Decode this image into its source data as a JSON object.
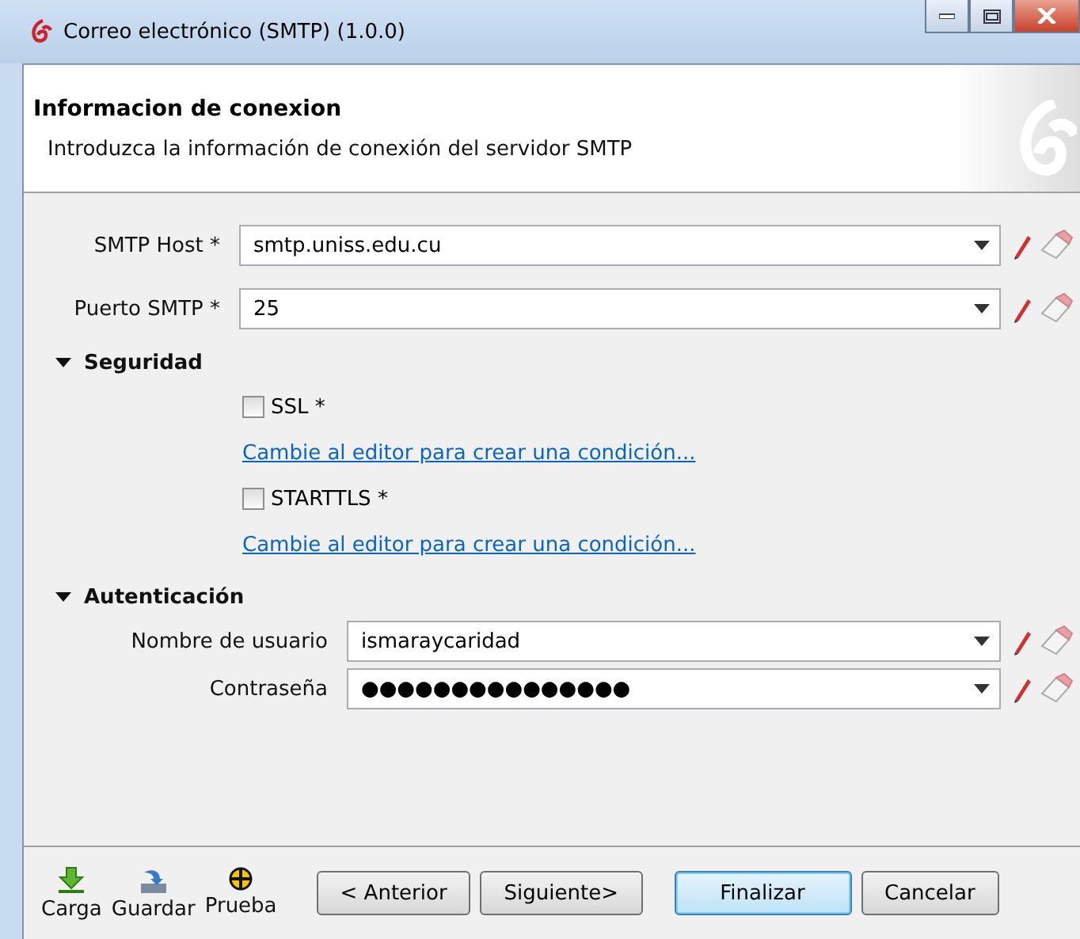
{
  "window": {
    "title": "Correo electrónico (SMTP) (1.0.0)"
  },
  "header": {
    "title": "Informacion de conexion",
    "subtitle": "Introduzca la información de conexión del servidor SMTP"
  },
  "fields": [
    {
      "label": "SMTP Host *",
      "value": "smtp.uniss.edu.cu"
    },
    {
      "label": "Puerto SMTP *",
      "value": "25"
    }
  ],
  "sections": [
    {
      "title": "Seguridad",
      "expanded": true,
      "kind": "options",
      "options": [
        {
          "label": "SSL *",
          "checked": false,
          "link": "Cambie al editor para crear una condición..."
        },
        {
          "label": "STARTTLS *",
          "checked": false,
          "link": "Cambie al editor para crear una condición..."
        }
      ]
    },
    {
      "title": "Autenticación",
      "expanded": true,
      "kind": "fields",
      "fields": [
        {
          "label": "Nombre de usuario",
          "value": "ismaraycaridad"
        },
        {
          "label": "Contraseña",
          "value": "●●●●●●●●●●●●●●●"
        }
      ]
    }
  ],
  "tools": [
    {
      "label": "Carga",
      "kind": "load"
    },
    {
      "label": "Guardar",
      "kind": "save"
    },
    {
      "label": "Prueba",
      "kind": "test"
    }
  ],
  "buttons": [
    {
      "label": "< Anterior",
      "default": false
    },
    {
      "label": "Siguiente>",
      "default": false
    },
    {
      "label": "Finalizar",
      "default": true
    },
    {
      "label": "Cancelar",
      "default": false
    }
  ]
}
